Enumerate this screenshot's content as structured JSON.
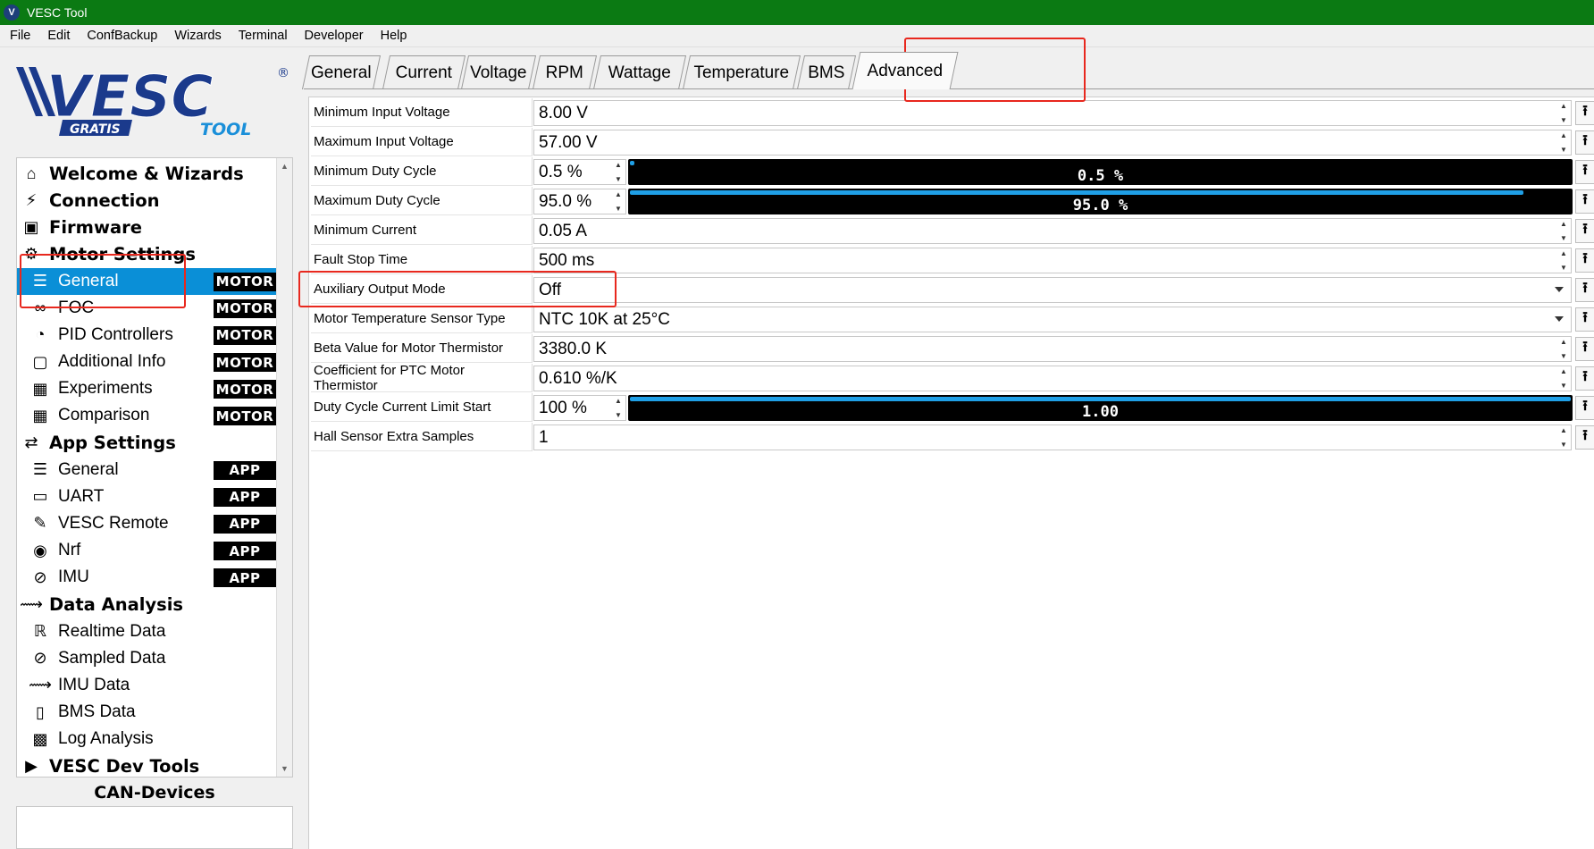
{
  "window": {
    "title": "VESC Tool"
  },
  "menu": [
    "File",
    "Edit",
    "ConfBackup",
    "Wizards",
    "Terminal",
    "Developer",
    "Help"
  ],
  "logo": {
    "main_text": "VESC",
    "registered": "®",
    "sub_left": "GRATIS",
    "sub_right": "TOOL"
  },
  "sidebar": {
    "items": [
      {
        "type": "cat",
        "label": "Welcome & Wizards",
        "icon": "home-icon"
      },
      {
        "type": "cat",
        "label": "Connection",
        "icon": "plug-icon"
      },
      {
        "type": "cat",
        "label": "Firmware",
        "icon": "chip-icon"
      },
      {
        "type": "cat",
        "label": "Motor Settings",
        "icon": "motor-icon"
      },
      {
        "type": "sub",
        "label": "General",
        "icon": "sliders-icon",
        "badge": "MOTOR",
        "selected": true
      },
      {
        "type": "sub",
        "label": "FOC",
        "icon": "coil-icon",
        "badge": "MOTOR"
      },
      {
        "type": "sub",
        "label": "PID Controllers",
        "icon": "gauge-icon",
        "badge": "MOTOR"
      },
      {
        "type": "sub",
        "label": "Additional Info",
        "icon": "info-icon",
        "badge": "MOTOR"
      },
      {
        "type": "sub",
        "label": "Experiments",
        "icon": "calculator-icon",
        "badge": "MOTOR"
      },
      {
        "type": "sub",
        "label": "Comparison",
        "icon": "calculator-icon",
        "badge": "MOTOR"
      },
      {
        "type": "cat",
        "label": "App Settings",
        "icon": "app-settings-icon"
      },
      {
        "type": "sub",
        "label": "General",
        "icon": "sliders-icon",
        "badge": "APP"
      },
      {
        "type": "sub",
        "label": "UART",
        "icon": "serial-port-icon",
        "badge": "APP"
      },
      {
        "type": "sub",
        "label": "VESC Remote",
        "icon": "remote-icon",
        "badge": "APP"
      },
      {
        "type": "sub",
        "label": "Nrf",
        "icon": "wireless-icon",
        "badge": "APP"
      },
      {
        "type": "sub",
        "label": "IMU",
        "icon": "imu-icon",
        "badge": "APP"
      },
      {
        "type": "cat",
        "label": "Data Analysis",
        "icon": "analysis-icon"
      },
      {
        "type": "sub",
        "label": "Realtime Data",
        "icon": "realtime-icon"
      },
      {
        "type": "sub",
        "label": "Sampled Data",
        "icon": "sampled-icon"
      },
      {
        "type": "sub",
        "label": "IMU Data",
        "icon": "imu-data-icon"
      },
      {
        "type": "sub",
        "label": "BMS Data",
        "icon": "battery-icon"
      },
      {
        "type": "sub",
        "label": "Log Analysis",
        "icon": "map-icon"
      },
      {
        "type": "cat",
        "label": "VESC Dev Tools",
        "icon": "terminal-icon"
      }
    ]
  },
  "can_devices": {
    "title": "CAN-Devices"
  },
  "tabs": [
    "General",
    "Current",
    "Voltage",
    "RPM",
    "Wattage",
    "Temperature",
    "BMS",
    "Advanced"
  ],
  "active_tab": "Advanced",
  "params": [
    {
      "label": "Minimum Input Voltage",
      "value": "8.00 V",
      "kind": "spin"
    },
    {
      "label": "Maximum Input Voltage",
      "value": "57.00 V",
      "kind": "spin"
    },
    {
      "label": "Minimum Duty Cycle",
      "value": "0.5 %",
      "kind": "bar",
      "bar_text": "0.5 %",
      "bar_fraction": 0.005
    },
    {
      "label": "Maximum Duty Cycle",
      "value": "95.0 %",
      "kind": "bar",
      "bar_text": "95.0 %",
      "bar_fraction": 0.95
    },
    {
      "label": "Minimum Current",
      "value": "0.05 A",
      "kind": "spin"
    },
    {
      "label": "Fault Stop Time",
      "value": "500 ms",
      "kind": "spin"
    },
    {
      "label": "Auxiliary Output Mode",
      "value": "Off",
      "kind": "combo"
    },
    {
      "label": "Motor Temperature Sensor Type",
      "value": "NTC 10K at 25°C",
      "kind": "combo"
    },
    {
      "label": "Beta Value for Motor Thermistor",
      "value": "3380.0 K",
      "kind": "spin"
    },
    {
      "label": "Coefficient for PTC Motor Thermistor",
      "value": "0.610 %/K",
      "kind": "spin"
    },
    {
      "label": "Duty Cycle Current Limit Start",
      "value": "100 %",
      "kind": "bar",
      "bar_text": "1.00",
      "bar_fraction": 1.0
    },
    {
      "label": "Hall Sensor Extra Samples",
      "value": "1",
      "kind": "spin"
    }
  ],
  "colors": {
    "titlebar": "#0b7a13",
    "selection": "#0a8fd7",
    "annotation": "#e8281e",
    "bar_fill": "#1f9fe6"
  }
}
